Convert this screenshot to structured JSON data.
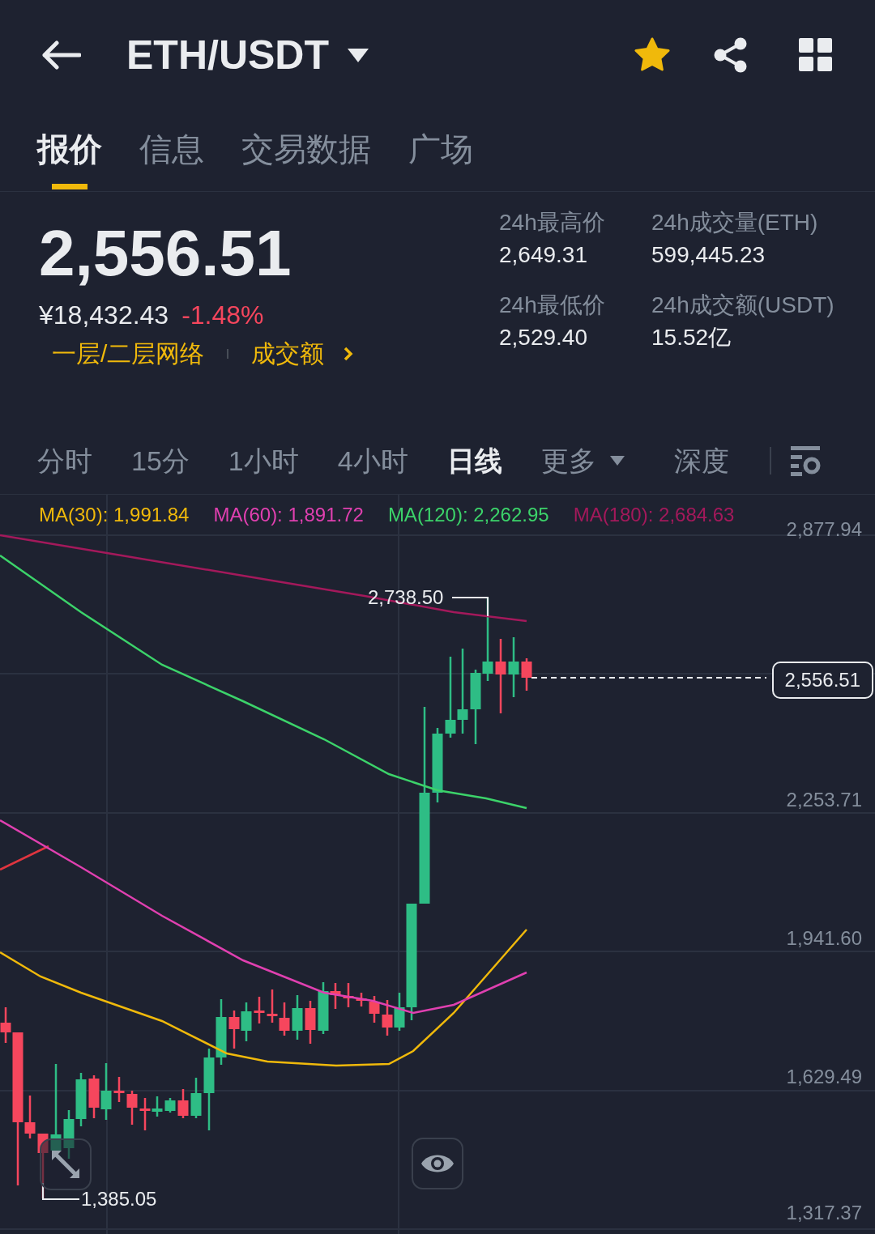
{
  "header": {
    "title": "ETH/USDT",
    "favorite": true
  },
  "tabs": [
    {
      "label": "报价",
      "selected": true
    },
    {
      "label": "信息",
      "selected": false
    },
    {
      "label": "交易数据",
      "selected": false
    },
    {
      "label": "广场",
      "selected": false
    }
  ],
  "price": {
    "last": "2,556.51",
    "cny": "¥18,432.43",
    "change": "-1.48%",
    "links": [
      "一层/二层网络",
      "成交额"
    ]
  },
  "stats": [
    {
      "label": "24h最高价",
      "value": "2,649.31"
    },
    {
      "label": "24h成交量(ETH)",
      "value": "599,445.23"
    },
    {
      "label": "24h最低价",
      "value": "2,529.40"
    },
    {
      "label": "24h成交额(USDT)",
      "value": "15.52亿"
    }
  ],
  "intervals": [
    {
      "label": "分时",
      "kind": "interval",
      "selected": false
    },
    {
      "label": "15分",
      "kind": "interval",
      "selected": false
    },
    {
      "label": "1小时",
      "kind": "interval",
      "selected": false
    },
    {
      "label": "4小时",
      "kind": "interval",
      "selected": false
    },
    {
      "label": "日线",
      "kind": "interval",
      "selected": true
    },
    {
      "label": "更多",
      "kind": "menu",
      "selected": false
    },
    {
      "label": "深度",
      "kind": "interval",
      "selected": false
    }
  ],
  "chart": {
    "ma_legend": [
      {
        "label": "MA(30): 1,991.84",
        "color": "#f0b90b"
      },
      {
        "label": "MA(60): 1,891.72",
        "color": "#e040b0"
      },
      {
        "label": "MA(120): 2,262.95",
        "color": "#3cd36a"
      },
      {
        "label": "MA(180): 2,684.63",
        "color": "#a3195b"
      }
    ],
    "price_axis": [
      "2,877.94",
      "2,253.71",
      "1,941.60",
      "1,629.49",
      "1,317.37"
    ],
    "current_price": "2,556.51",
    "high_marker": "2,738.50",
    "low_marker": "1,385.05"
  }
}
